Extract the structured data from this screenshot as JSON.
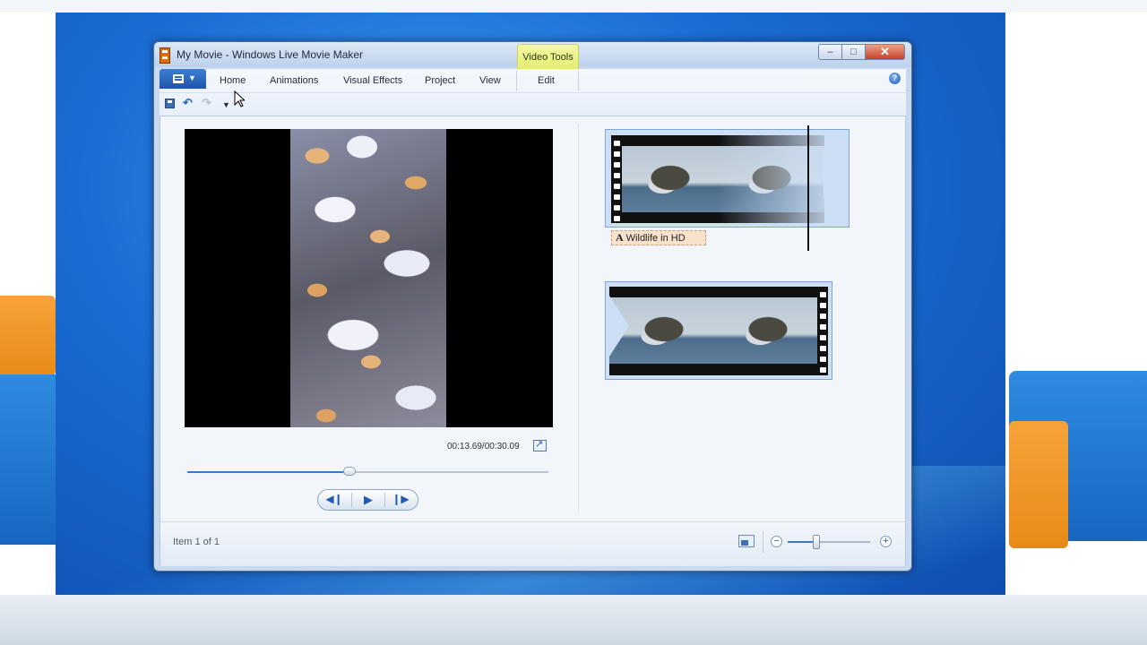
{
  "window": {
    "title": "My Movie - Windows Live Movie Maker",
    "minimize_glyph": "–",
    "maximize_glyph": "□",
    "close_glyph": "✕"
  },
  "ribbon": {
    "contextual_group": "Video Tools",
    "tabs": [
      "Home",
      "Animations",
      "Visual Effects",
      "Project",
      "View",
      "Edit"
    ],
    "help_glyph": "?"
  },
  "quick_access": {
    "icons": [
      "save-icon",
      "undo-icon",
      "redo-icon",
      "customize-dropdown-icon"
    ]
  },
  "preview": {
    "timecode": "00:13.69/00:30.09",
    "progress": 0.45,
    "controls": {
      "previous_frame_glyph": "◀❙",
      "play_glyph": "▶",
      "next_frame_glyph": "❙▶"
    }
  },
  "storyboard": {
    "caption_icon_glyph": "A",
    "caption_text": "Wildlife in HD"
  },
  "status": {
    "item_text": "Item 1 of 1",
    "zoom_level": 0.35
  },
  "colors": {
    "accent": "#3a78c8",
    "contextual_tab": "#e3ec6e",
    "close_button": "#c8412a"
  }
}
